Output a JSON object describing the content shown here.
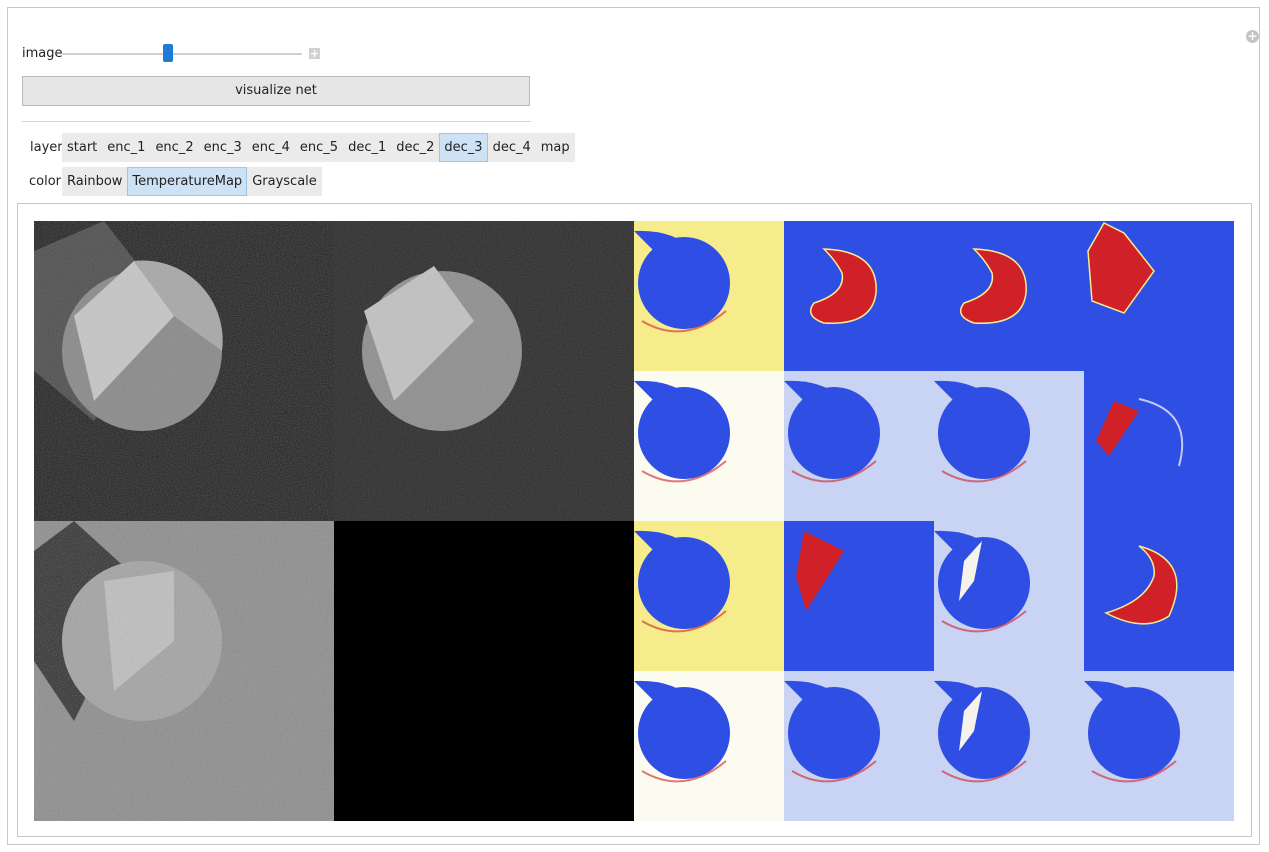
{
  "controls": {
    "image_label": "image",
    "image_slider_value": 0.45,
    "visualize_label": "visualize net",
    "layer_label": "layer",
    "layers": [
      "start",
      "enc_1",
      "enc_2",
      "enc_3",
      "enc_4",
      "enc_5",
      "dec_1",
      "dec_2",
      "dec_3",
      "dec_4",
      "map"
    ],
    "layer_selected": "dec_3",
    "color_label": "color",
    "colors": [
      "Rainbow",
      "TemperatureMap",
      "Grayscale"
    ],
    "color_selected": "TemperatureMap"
  },
  "icons": {
    "corner": "plus-circle-icon",
    "slider_expand": "plus-square-icon"
  },
  "palette": {
    "selected_bg": "#cde3f5",
    "slider_thumb": "#1e7bd6",
    "temp_blue": "#2f4ee3",
    "temp_red": "#cf2127",
    "temp_yellow": "#f7ec8c",
    "temp_white": "#fbfbf0"
  }
}
